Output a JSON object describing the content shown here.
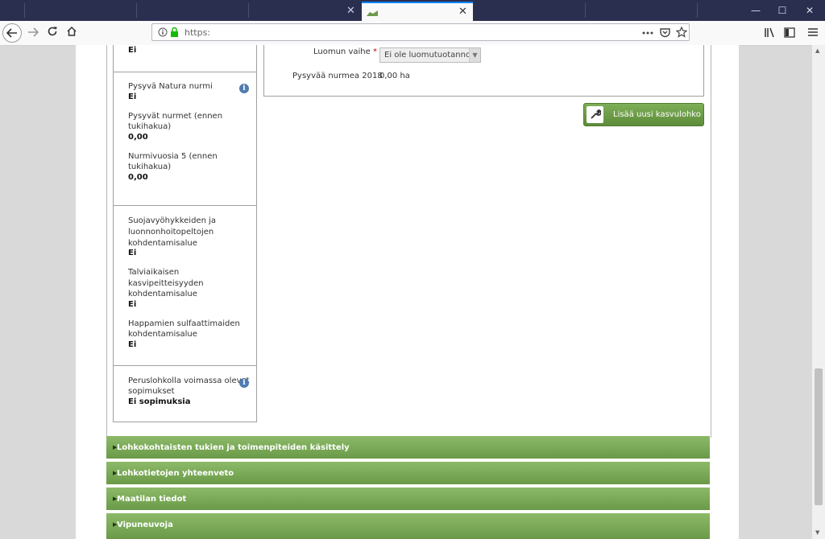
{
  "browser": {
    "url": "https:",
    "win_minimize": "—",
    "win_maximize": "☐",
    "win_close": "✕",
    "tab_close": "✕"
  },
  "left_panel": {
    "top_value": "Ei",
    "natura_label": "Pysyvä Natura nurmi",
    "natura_value": "Ei",
    "pysyvat_label_1": "Pysyvät nurmet (ennen",
    "pysyvat_label_2": "tukihakua)",
    "pysyvat_value": "0,00",
    "nurmivuosia_label_1": "Nurmivuosia 5 (ennen",
    "nurmivuosia_label_2": "tukihakua)",
    "nurmivuosia_value": "0,00",
    "suoja_label_1": "Suojavyöhykkeiden ja",
    "suoja_label_2": "luonnonhoitopeltojen",
    "suoja_label_3": "kohdentamisalue",
    "suoja_value": "Ei",
    "talvi_label_1": "Talviaikaisen",
    "talvi_label_2": "kasvipeitteisyyden",
    "talvi_label_3": "kohdentamisalue",
    "talvi_value": "Ei",
    "happamien_label_1": "Happamien sulfaattimaiden",
    "happamien_label_2": "kohdentamisalue",
    "happamien_value": "Ei",
    "sopimukset_label_1": "Peruslohkolla voimassa olevat",
    "sopimukset_label_2": "sopimukset",
    "sopimukset_value": "Ei sopimuksia",
    "info_glyph": "i"
  },
  "right_panel": {
    "luomun_label": "Luomun vaihe",
    "required_marker": "*",
    "luomun_value": "Ei ole luomutuotannossa",
    "pysyvaa_label": "Pysyvää nurmea 2018",
    "pysyvaa_value": "0,00 ha",
    "add_button": "Lisää uusi kasvulohko"
  },
  "accordions": [
    {
      "label": "Lohkokohtaisten tukien ja toimenpiteiden käsittely"
    },
    {
      "label": "Lohkotietojen yhteenveto"
    },
    {
      "label": "Maatilan tiedot"
    },
    {
      "label": "Vipuneuvoja"
    }
  ]
}
